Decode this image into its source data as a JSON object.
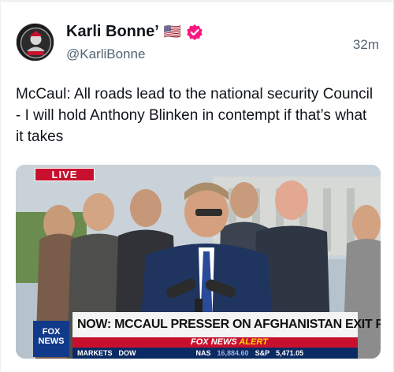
{
  "author": {
    "name": "Karli Bonne’",
    "handle": "@KarliBonne",
    "flag": "🇺🇸",
    "verified_color": "#f91880"
  },
  "time": "32m",
  "text": "McCaul: All roads lead to the national security Council - I will hold Anthony Blinken in contempt if that’s what it takes",
  "media": {
    "live_label": "LIVE",
    "headline": "NOW: MCCAUL PRESSER ON AFGHANISTAN EXIT PROBE",
    "alert_prefix": "FOX NEWS",
    "alert_word": "ALERT",
    "channel_logo_top": "FOX",
    "channel_logo_bottom": "NEWS",
    "ticker_label": "MARKETS",
    "ticker_dow": "DOW",
    "ticker_nas": "NAS",
    "ticker_nas_val": "16,884.60",
    "ticker_sp": "S&P",
    "ticker_sp_val": "5,471.05"
  },
  "colors": {
    "accent_red": "#c8102e",
    "fox_blue": "#0b2a63"
  }
}
